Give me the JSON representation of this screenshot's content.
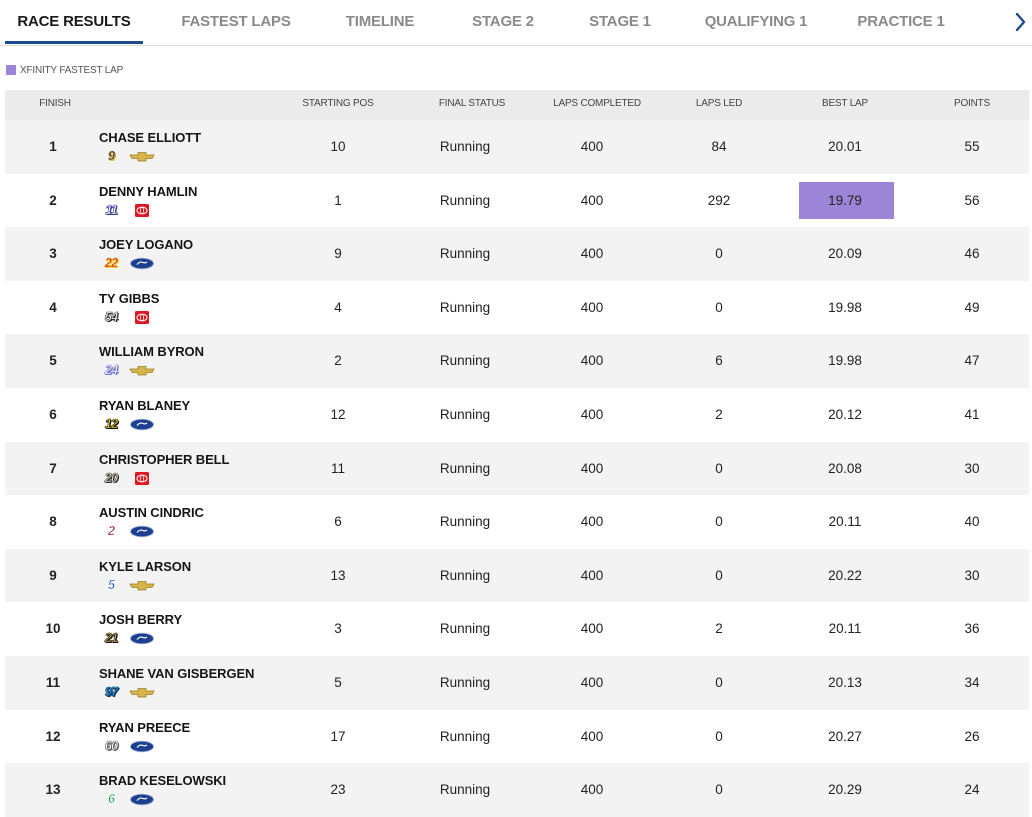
{
  "tabs": [
    {
      "label": "RACE RESULTS",
      "active": true
    },
    {
      "label": "FASTEST LAPS",
      "active": false
    },
    {
      "label": "TIMELINE",
      "active": false
    },
    {
      "label": "STAGE 2",
      "active": false
    },
    {
      "label": "STAGE 1",
      "active": false
    },
    {
      "label": "QUALIFYING 1",
      "active": false
    },
    {
      "label": "PRACTICE 1",
      "active": false
    }
  ],
  "legend": {
    "label": "XFINITY FASTEST LAP",
    "color": "#9c84d6"
  },
  "columns": {
    "finish": "FINISH",
    "starting_pos": "STARTING POS",
    "final_status": "FINAL STATUS",
    "laps_completed": "LAPS COMPLETED",
    "laps_led": "LAPS LED",
    "best_lap": "BEST LAP",
    "points": "POINTS"
  },
  "rows": [
    {
      "finish": "1",
      "driver": "CHASE ELLIOTT",
      "car": "9",
      "car_color": "#1a2a8a",
      "car_stroke": "#e2b526",
      "mfr": "chevrolet",
      "start": "10",
      "status": "Running",
      "laps": "400",
      "led": "84",
      "best": "20.01",
      "points": "55",
      "fastest": false
    },
    {
      "finish": "2",
      "driver": "DENNY HAMLIN",
      "car": "11",
      "car_color": "#ffffff",
      "car_stroke": "#3b3b8c",
      "mfr": "toyota",
      "start": "1",
      "status": "Running",
      "laps": "400",
      "led": "292",
      "best": "19.79",
      "points": "56",
      "fastest": true
    },
    {
      "finish": "3",
      "driver": "JOEY LOGANO",
      "car": "22",
      "car_color": "#d11b2a",
      "car_stroke": "#f4d23b",
      "mfr": "ford",
      "start": "9",
      "status": "Running",
      "laps": "400",
      "led": "0",
      "best": "20.09",
      "points": "46",
      "fastest": false
    },
    {
      "finish": "4",
      "driver": "TY GIBBS",
      "car": "54",
      "car_color": "#ffffff",
      "car_stroke": "#333333",
      "mfr": "toyota",
      "start": "4",
      "status": "Running",
      "laps": "400",
      "led": "0",
      "best": "19.98",
      "points": "49",
      "fastest": false
    },
    {
      "finish": "5",
      "driver": "WILLIAM BYRON",
      "car": "24",
      "car_color": "#ffffff",
      "car_stroke": "#6c78c8",
      "mfr": "chevrolet",
      "start": "2",
      "status": "Running",
      "laps": "400",
      "led": "6",
      "best": "19.98",
      "points": "47",
      "fastest": false
    },
    {
      "finish": "6",
      "driver": "RYAN BLANEY",
      "car": "12",
      "car_color": "#f4d21a",
      "car_stroke": "#111111",
      "mfr": "ford",
      "start": "12",
      "status": "Running",
      "laps": "400",
      "led": "2",
      "best": "20.12",
      "points": "41",
      "fastest": false
    },
    {
      "finish": "7",
      "driver": "CHRISTOPHER BELL",
      "car": "20",
      "car_color": "#e8dcc0",
      "car_stroke": "#333333",
      "mfr": "toyota",
      "start": "11",
      "status": "Running",
      "laps": "400",
      "led": "0",
      "best": "20.08",
      "points": "30",
      "fastest": false
    },
    {
      "finish": "8",
      "driver": "AUSTIN CINDRIC",
      "car": "2",
      "car_color": "#8a1020",
      "car_stroke": "#ffffff",
      "mfr": "ford",
      "start": "6",
      "status": "Running",
      "laps": "400",
      "led": "0",
      "best": "20.11",
      "points": "40",
      "fastest": false
    },
    {
      "finish": "9",
      "driver": "KYLE LARSON",
      "car": "5",
      "car_color": "#1c4db8",
      "car_stroke": "#ffffff",
      "mfr": "chevrolet",
      "start": "13",
      "status": "Running",
      "laps": "400",
      "led": "0",
      "best": "20.22",
      "points": "30",
      "fastest": false
    },
    {
      "finish": "10",
      "driver": "JOSH BERRY",
      "car": "21",
      "car_color": "#c9a24a",
      "car_stroke": "#1a1a1a",
      "mfr": "ford",
      "start": "3",
      "status": "Running",
      "laps": "400",
      "led": "2",
      "best": "20.11",
      "points": "36",
      "fastest": false
    },
    {
      "finish": "11",
      "driver": "SHANE VAN GISBERGEN",
      "car": "97",
      "car_color": "#2aa0dd",
      "car_stroke": "#0b2b5a",
      "mfr": "chevrolet",
      "start": "5",
      "status": "Running",
      "laps": "400",
      "led": "0",
      "best": "20.13",
      "points": "34",
      "fastest": false
    },
    {
      "finish": "12",
      "driver": "RYAN PREECE",
      "car": "60",
      "car_color": "#ffffff",
      "car_stroke": "#555555",
      "mfr": "ford",
      "start": "17",
      "status": "Running",
      "laps": "400",
      "led": "0",
      "best": "20.27",
      "points": "26",
      "fastest": false
    },
    {
      "finish": "13",
      "driver": "BRAD KESELOWSKI",
      "car": "6",
      "car_color": "#1f9a4a",
      "car_stroke": "#ffffff",
      "mfr": "ford",
      "start": "23",
      "status": "Running",
      "laps": "400",
      "led": "0",
      "best": "20.29",
      "points": "24",
      "fastest": false
    }
  ]
}
